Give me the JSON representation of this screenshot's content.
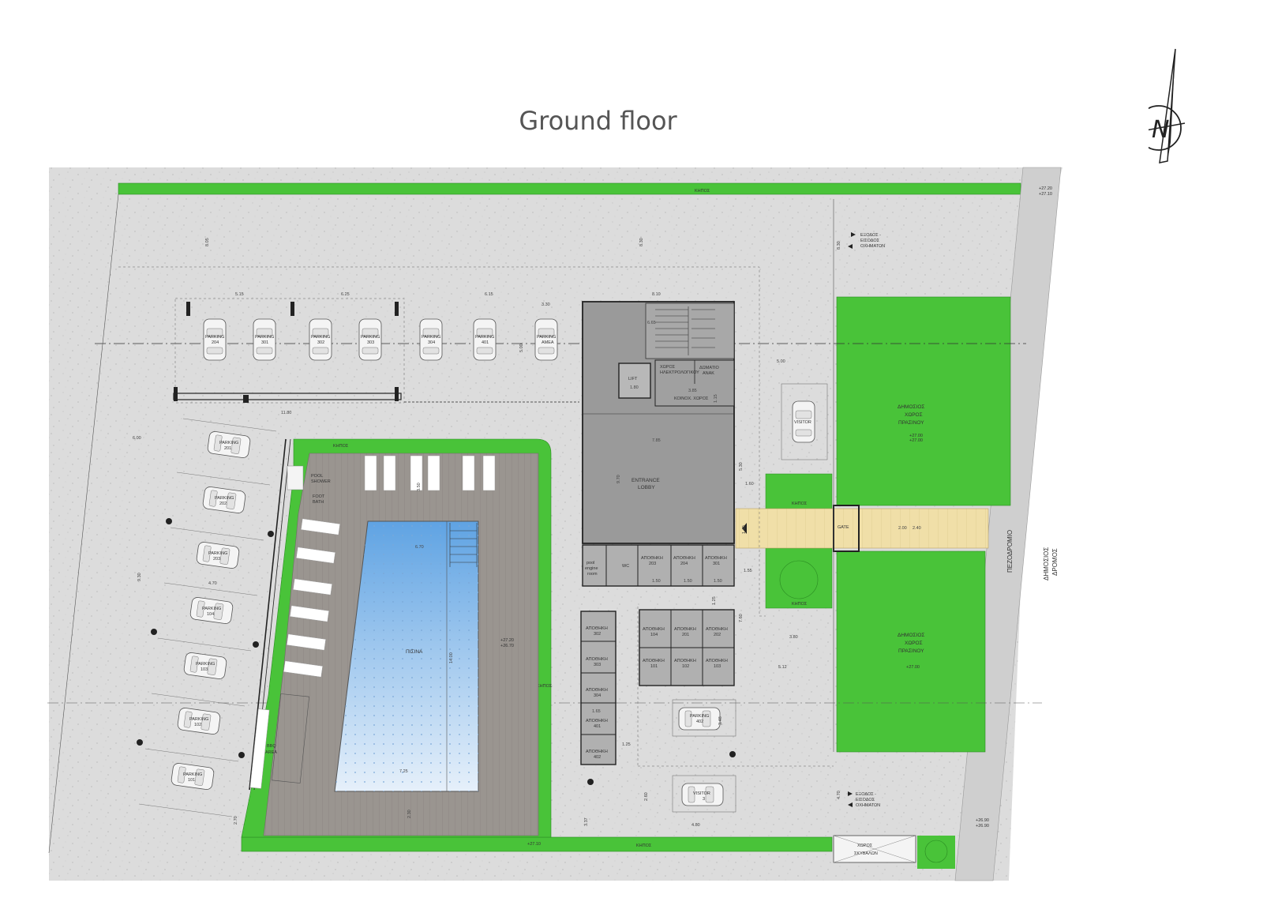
{
  "title": "Ground floor",
  "compass_letter": "N",
  "colors": {
    "paving": "#dcdcdc",
    "garden": "#49c339",
    "building": "#9a9a9a",
    "deck": "#9a9590",
    "pool": "#9fc7ec",
    "walkway": "#f0dfa8"
  },
  "labels": {
    "kipos": "ΚΗΠΟΣ",
    "public_green_1": [
      "ΔΗΜΟΣΙΟΣ",
      "ΧΩΡΟΣ",
      "ΠΡΑΣΙΝΟΥ"
    ],
    "public_green_2": [
      "ΔΗΜΟΣΙΟΣ",
      "ΧΩΡΟΣ",
      "ΠΡΑΣΙΝΟΥ"
    ],
    "pezodromio": "ΠΕΖΟΔΡΟΜΙΟ",
    "dimosios_dromos": [
      "ΔΗΜΟΣΙΟΣ",
      "ΔΡΟΜΟΣ"
    ],
    "gate": "GATE",
    "entrance_lobby": [
      "ENTRANCE",
      "LOBBY"
    ],
    "pool": "ΠΙΣΙΝΑ",
    "pool_shower": [
      "POOL",
      "SHOWER"
    ],
    "foot_bath": [
      "FOOT",
      "BATH"
    ],
    "bbq": [
      "BBQ",
      "AREA"
    ],
    "lift": "LIFT",
    "wc": "WC",
    "pool_engine": [
      "pool",
      "engine",
      "room"
    ],
    "xoros_ilektrologiko": [
      "ΧΩΡΟΣ",
      "ΗΛΕΚΤΡΟΛΟΓΙΚΟΥ"
    ],
    "domatio": [
      "ΔΩΜΑΤΙΟ",
      "ΑΝΑΚ"
    ],
    "koinoxristos": "ΚΟΙΝΟΧ. ΧΩΡΟΣ",
    "visitor": "VISITOR",
    "visitor_3": [
      "VISITOR",
      "3"
    ],
    "parking_402": [
      "PARKING",
      "402"
    ],
    "exit_top": [
      "ΕΞΟΔΟΣ -",
      "ΕΙΣΟΔΟΣ",
      "ΟΧΗΜΑΤΩΝ"
    ],
    "exit_bottom": [
      "ΕΞΟΔΟΣ -",
      "ΕΙΣΟΔΟΣ",
      "ΟΧΗΜΑΤΩΝ"
    ],
    "bin_area": [
      "ΧΩΡΟΣ",
      "ΣΚΥΒΑΛΩΝ"
    ],
    "level_a": "+27.20",
    "level_a_sub": "+27.10",
    "level_b": "+27.00",
    "level_b_sub": "+27.00",
    "level_c": "+26.90",
    "level_c_sub": "+26.90",
    "level_d": "+27.10",
    "level_pool": "+27.20",
    "level_pool_sub": "+26.70"
  },
  "top_parking": [
    [
      "PARKING",
      "204"
    ],
    [
      "PARKING",
      "301"
    ],
    [
      "PARKING",
      "302"
    ],
    [
      "PARKING",
      "303"
    ],
    [
      "PARKING",
      "304"
    ],
    [
      "PARKING",
      "401"
    ],
    [
      "PARKING",
      "ΑΜΕΑ"
    ]
  ],
  "left_parking": [
    [
      "PARKING",
      "201"
    ],
    [
      "PARKING",
      "202"
    ],
    [
      "PARKING",
      "203"
    ],
    [
      "PARKING",
      "104"
    ],
    [
      "PARKING",
      "103"
    ],
    [
      "PARKING",
      "102"
    ],
    [
      "PARKING",
      "101"
    ]
  ],
  "storage_top": [
    [
      "ΑΠΟΘΗΚΗ",
      "203"
    ],
    [
      "ΑΠΟΘΗΚΗ",
      "204"
    ],
    [
      "ΑΠΟΘΗΚΗ",
      "301"
    ]
  ],
  "storage_mid_row1": [
    [
      "ΑΠΟΘΗΚΗ",
      "104"
    ],
    [
      "ΑΠΟΘΗΚΗ",
      "201"
    ],
    [
      "ΑΠΟΘΗΚΗ",
      "202"
    ]
  ],
  "storage_mid_row2": [
    [
      "ΑΠΟΘΗΚΗ",
      "101"
    ],
    [
      "ΑΠΟΘΗΚΗ",
      "102"
    ],
    [
      "ΑΠΟΘΗΚΗ",
      "103"
    ]
  ],
  "storage_left": [
    [
      "ΑΠΟΘΗΚΗ",
      "302"
    ],
    [
      "ΑΠΟΘΗΚΗ",
      "303"
    ],
    [
      "ΑΠΟΘΗΚΗ",
      "304"
    ],
    [
      "ΑΠΟΘΗΚΗ",
      "401"
    ],
    [
      "ΑΠΟΘΗΚΗ",
      "402"
    ]
  ],
  "dimensions": {
    "d_805": "8.05",
    "d_830": "8.30",
    "d_830b": "8.30",
    "d_515": "5.15",
    "d_625": "6.25",
    "d_615": "6.15",
    "d_330": "3.30",
    "d_810": "8.10",
    "d_1180": "11.80",
    "d_500": "5.00",
    "d_500b": "5.00",
    "d_600": "6.00",
    "d_665": "6.65",
    "d_180": "1.80",
    "d_385": "3.85",
    "d_115": "1.15",
    "d_785": "7.85",
    "d_970": "9.70",
    "d_530": "5.30",
    "d_160": "1.60",
    "d_140": "1.40",
    "d_200": "2.00",
    "d_240": "2.40",
    "d_350": "3.50",
    "d_670": "6.70",
    "d_1400": "14.00",
    "d_725": "7.25",
    "d_230": "2.30",
    "d_930": "9.30",
    "d_480": "4.80",
    "d_150": "1.50",
    "d_155": "1.55",
    "d_125": "1.25",
    "d_760": "7.60",
    "d_380": "3.80",
    "d_512": "5.12",
    "d_348": "3.48",
    "d_260": "2.60",
    "d_337": "3.37",
    "d_480b": "4.80",
    "d_270": "2.70",
    "d_470": "4.70",
    "d_470b": "4.70",
    "d_165": "1.65"
  }
}
